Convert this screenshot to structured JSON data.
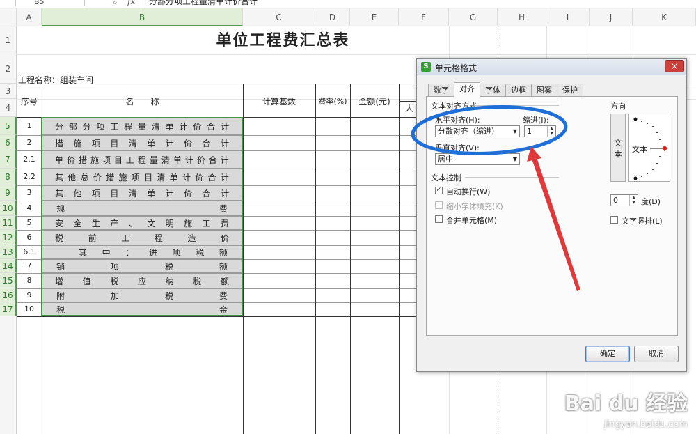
{
  "formula_bar": {
    "cell_ref": "B5",
    "fx": "fx",
    "content": "分部分项工程量清单计价合计"
  },
  "columns": [
    "A",
    "B",
    "C",
    "D",
    "E",
    "F",
    "G",
    "H",
    "I",
    "J",
    "K"
  ],
  "rows": [
    "1",
    "2",
    "3",
    "4",
    "5",
    "6",
    "7",
    "8",
    "9",
    "10",
    "11",
    "12",
    "13",
    "14",
    "15",
    "16",
    "17"
  ],
  "sheet": {
    "title": "单位工程费汇总表",
    "project": "工程名称：组装车间",
    "headers": {
      "seq": "序号",
      "name": "名　　称",
      "base": "计算基数",
      "rate": "费率(%)",
      "amount": "金额(元)",
      "partial": "人"
    },
    "items": [
      {
        "no": "1",
        "name": "分部分项工程量清单计价合计"
      },
      {
        "no": "2",
        "name": "措施项目清单计价合计"
      },
      {
        "no": "2.1",
        "name": "单价措施项目工程量清单计价合计"
      },
      {
        "no": "2.2",
        "name": "其他总价措施项目清单计价合计"
      },
      {
        "no": "3",
        "name": "其他项目清单计价合计"
      },
      {
        "no": "4",
        "name": "规费"
      },
      {
        "no": "5",
        "name": "安全生产、文明施工费"
      },
      {
        "no": "6",
        "name": "税前工程造价"
      },
      {
        "no": "6.1",
        "name": "其中：进项税额"
      },
      {
        "no": "7",
        "name": "销项税额"
      },
      {
        "no": "8",
        "name": "增值税应纳税额"
      },
      {
        "no": "9",
        "name": "附加税费"
      },
      {
        "no": "10",
        "name": "税金"
      }
    ]
  },
  "dialog": {
    "title": "单元格格式",
    "app_icon": "S",
    "close": "×",
    "tabs": [
      "数字",
      "对齐",
      "字体",
      "边框",
      "图案",
      "保护"
    ],
    "active_tab": "对齐",
    "section_align": "文本对齐方式",
    "h_align_label": "水平对齐(H):",
    "h_align_value": "分散对齐（缩进）",
    "indent_label": "缩进(I):",
    "indent_value": "1",
    "v_align_label": "垂直对齐(V):",
    "v_align_value": "居中",
    "section_control": "文本控制",
    "wrap_label": "自动换行(W)",
    "wrap_checked": true,
    "shrink_label": "缩小字体填充(K)",
    "merge_label": "合并单元格(M)",
    "direction_label": "方向",
    "vertical_text": "文本",
    "dial_text": "文本",
    "degree_value": "0",
    "degree_label": "度(D)",
    "stack_label": "文字竖排(L)",
    "ok": "确定",
    "cancel": "取消"
  },
  "annotation": {
    "circle_color": "#1f6fd8",
    "arrow_color": "#e0393b"
  },
  "watermark": {
    "brand": "Bai du 经验",
    "url": "jingyan.baidu.com"
  }
}
